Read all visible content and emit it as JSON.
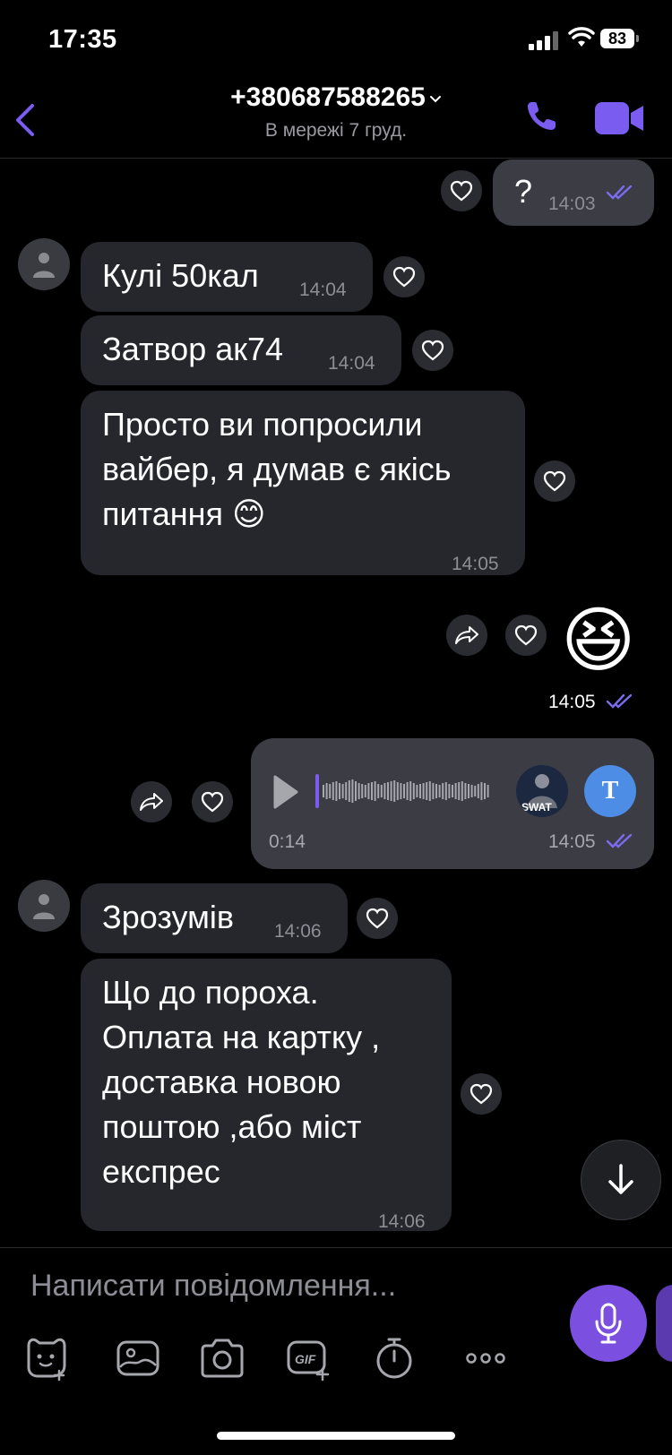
{
  "status_bar": {
    "time": "17:35",
    "battery": "83"
  },
  "header": {
    "contact": "+380687588265",
    "status": "В мережі 7 груд."
  },
  "messages": [
    {
      "text": "?",
      "time": "14:03"
    },
    {
      "text": "Кулі 50кал",
      "time": "14:04"
    },
    {
      "text": "Затвор ак74",
      "time": "14:04"
    },
    {
      "lines": [
        "Просто ви попросили",
        "вайбер, я думав є якісь",
        "питання 😊"
      ],
      "time": "14:05"
    },
    {
      "emoji": "😆",
      "time": "14:05"
    },
    {
      "duration": "0:14",
      "time": "14:05",
      "avatar_label": "SWAT",
      "transcribe_label": "T"
    },
    {
      "text": "Зрозумів",
      "time": "14:06"
    },
    {
      "lines": [
        "Що до пороха.",
        "Оплата на картку ,",
        "доставка новою",
        "поштою ,або міст",
        "експрес"
      ],
      "time": "14:06"
    }
  ],
  "composer": {
    "placeholder": "Написати повідомлення..."
  },
  "toolbar_icons": [
    "sticker-icon",
    "gallery-icon",
    "camera-icon",
    "gif-icon",
    "timer-icon",
    "more-icon"
  ],
  "colors": {
    "accent": "#7b4fe0",
    "bubble_in": "#26272d",
    "bubble_out": "#3b3c44"
  }
}
